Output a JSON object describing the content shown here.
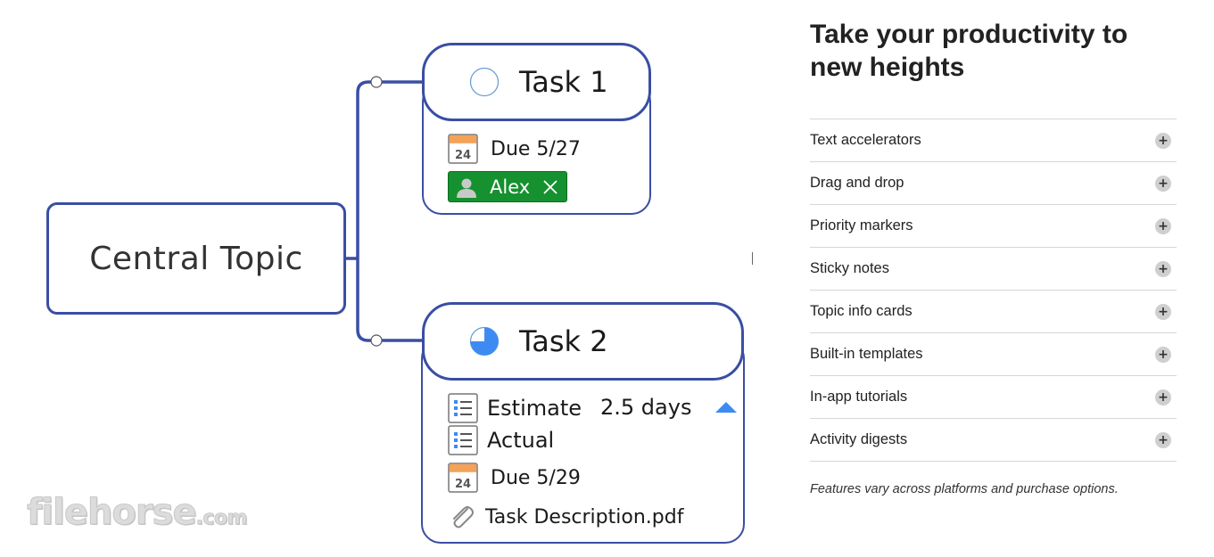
{
  "mindmap": {
    "central_topic": "Central Topic",
    "task1": {
      "title": "Task 1",
      "status": "not started",
      "due": "Due 5/27",
      "calendar_day": "24",
      "assignee": "Alex"
    },
    "task2": {
      "title": "Task 2",
      "status": "in progress",
      "progress_fraction": 0.75,
      "estimate_label": "Estimate",
      "estimate_value": "2.5 days",
      "actual_label": "Actual",
      "due": "Due 5/29",
      "calendar_day": "24",
      "attachment": "Task Description.pdf"
    },
    "colors": {
      "border": "#3a4ea3",
      "tag_green": "#15912f",
      "accent_blue": "#3d8bf2",
      "calendar_orange": "#f4a25a"
    },
    "icons": [
      "status-circle-icon",
      "progress-pie-icon",
      "calendar-icon",
      "person-icon",
      "close-icon",
      "list-icon",
      "caret-up-icon",
      "paperclip-icon"
    ]
  },
  "watermark": {
    "main": "filehorse",
    "domain": ".com"
  },
  "panel": {
    "heading": "Take your productivity to new heights",
    "features": [
      {
        "label": "Text accelerators"
      },
      {
        "label": "Drag and drop"
      },
      {
        "label": "Priority markers"
      },
      {
        "label": "Sticky notes"
      },
      {
        "label": "Topic info cards"
      },
      {
        "label": "Built-in templates"
      },
      {
        "label": "In-app tutorials"
      },
      {
        "label": "Activity digests"
      }
    ],
    "expand_icon": "plus-icon",
    "footnote": "Features vary across platforms and purchase options."
  }
}
